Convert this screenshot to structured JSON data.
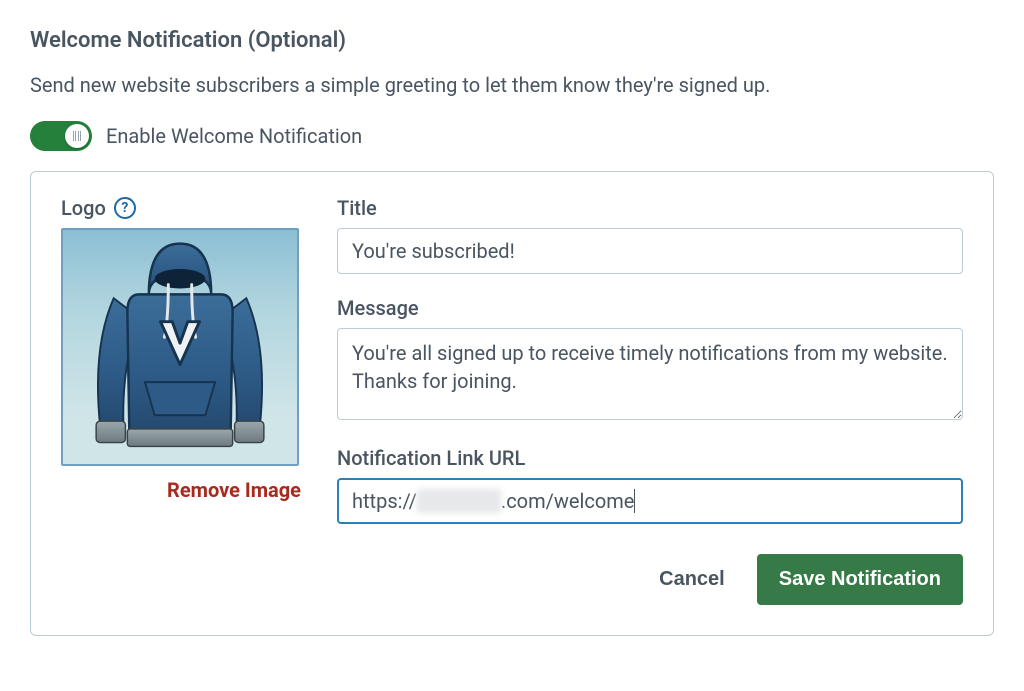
{
  "header": {
    "title": "Welcome Notification (Optional)",
    "description": "Send new website subscribers a simple greeting to let them know they're signed up."
  },
  "toggle": {
    "label": "Enable Welcome Notification",
    "enabled": true
  },
  "logo": {
    "label": "Logo",
    "help": "?",
    "remove_label": "Remove Image"
  },
  "fields": {
    "title": {
      "label": "Title",
      "value": "You're subscribed!"
    },
    "message": {
      "label": "Message",
      "value": "You're all signed up to receive timely notifications from my website. Thanks for joining."
    },
    "url": {
      "label": "Notification Link URL",
      "prefix": "https://",
      "suffix": ".com/welcome",
      "obscured_placeholder": "____"
    }
  },
  "buttons": {
    "cancel": "Cancel",
    "save": "Save Notification"
  }
}
